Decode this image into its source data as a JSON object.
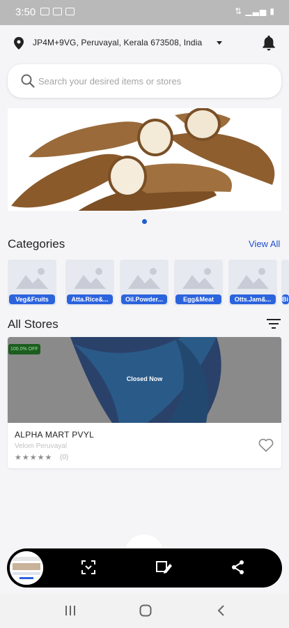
{
  "status_bar": {
    "time": "3:50"
  },
  "header": {
    "location": "JP4M+9VG, Peruvayal, Kerala 673508, India"
  },
  "search": {
    "placeholder": "Search your desired items or stores"
  },
  "categories": {
    "title": "Categories",
    "view_all": "View All",
    "items": [
      {
        "label": "Veg&Fruits"
      },
      {
        "label": "Atta.Rice&..."
      },
      {
        "label": "Oil.Powder..."
      },
      {
        "label": "Egg&Meat"
      },
      {
        "label": "Otts.Jam&..."
      },
      {
        "label": "Bi"
      }
    ]
  },
  "stores": {
    "title": "All Stores",
    "items": [
      {
        "discount": "100.0% OFF",
        "status": "Closed Now",
        "name": "ALPHA MART PVYL",
        "area": "Velom Peruvayal",
        "stars": "★★★★★",
        "rating_count": "(0)"
      }
    ]
  },
  "icons": {
    "location": "location-pin-icon",
    "notification": "bell-icon",
    "search": "search-icon",
    "filter": "filter-icon",
    "favorite": "heart-outline-icon",
    "scan": "scan-icon",
    "edit": "edit-crop-icon",
    "share": "share-icon"
  },
  "colors": {
    "accent": "#2b63dd",
    "link": "#1f4fcf",
    "discount_bg": "#1c5d1f",
    "toolbar": "#000000"
  }
}
